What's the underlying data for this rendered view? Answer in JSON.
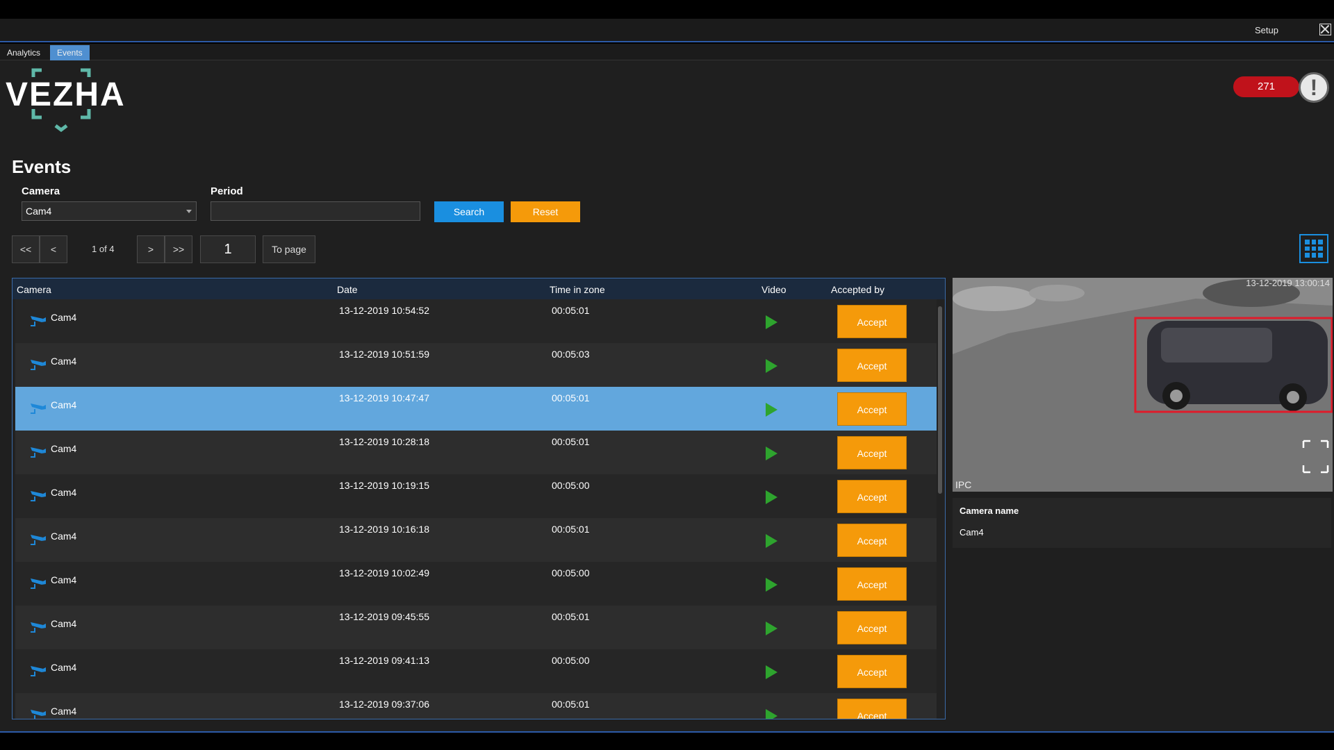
{
  "window": {
    "setup_label": "Setup"
  },
  "tabs": [
    {
      "label": "Analytics",
      "active": false
    },
    {
      "label": "Events",
      "active": true
    }
  ],
  "brand": {
    "logo_text": "VEZHA"
  },
  "alerts": {
    "count": "271"
  },
  "page": {
    "title": "Events"
  },
  "filters": {
    "camera_label": "Camera",
    "camera_value": "Cam4",
    "period_label": "Period",
    "period_value": "",
    "search_label": "Search",
    "reset_label": "Reset"
  },
  "pager": {
    "first": "<<",
    "prev": "<",
    "info": "1 of 4",
    "next": ">",
    "last": ">>",
    "page_input": "1",
    "to_page": "To page"
  },
  "table": {
    "columns": [
      "Camera",
      "Date",
      "Time in zone",
      "Video",
      "Accepted by"
    ],
    "accept_label": "Accept",
    "selected_index": 2,
    "rows": [
      {
        "camera": "Cam4",
        "date": "13-12-2019 10:54:52",
        "time_in_zone": "00:05:01"
      },
      {
        "camera": "Cam4",
        "date": "13-12-2019 10:51:59",
        "time_in_zone": "00:05:03"
      },
      {
        "camera": "Cam4",
        "date": "13-12-2019 10:47:47",
        "time_in_zone": "00:05:01"
      },
      {
        "camera": "Cam4",
        "date": "13-12-2019 10:28:18",
        "time_in_zone": "00:05:01"
      },
      {
        "camera": "Cam4",
        "date": "13-12-2019 10:19:15",
        "time_in_zone": "00:05:00"
      },
      {
        "camera": "Cam4",
        "date": "13-12-2019 10:16:18",
        "time_in_zone": "00:05:01"
      },
      {
        "camera": "Cam4",
        "date": "13-12-2019 10:02:49",
        "time_in_zone": "00:05:00"
      },
      {
        "camera": "Cam4",
        "date": "13-12-2019 09:45:55",
        "time_in_zone": "00:05:01"
      },
      {
        "camera": "Cam4",
        "date": "13-12-2019 09:41:13",
        "time_in_zone": "00:05:00"
      },
      {
        "camera": "Cam4",
        "date": "13-12-2019 09:37:06",
        "time_in_zone": "00:05:01"
      }
    ]
  },
  "preview": {
    "timestamp": "13-12-2019 13:00:14",
    "overlay_label": "IPC",
    "camera_name_label": "Camera name",
    "camera_name_value": "Cam4"
  },
  "colors": {
    "accent_blue": "#1a8fe0",
    "accept_orange": "#f59a0a",
    "selected_row": "#62a7dd",
    "alert_red": "#c0121b",
    "play_green": "#2ea42e"
  }
}
